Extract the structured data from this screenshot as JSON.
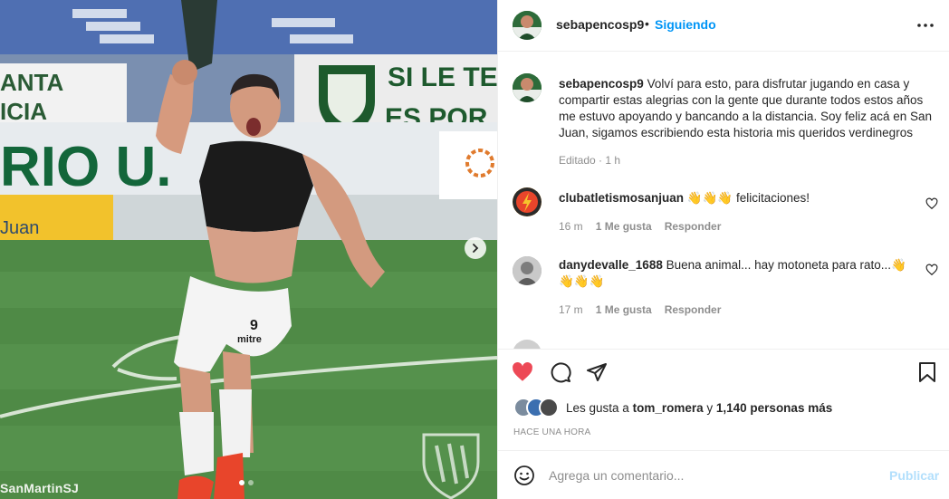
{
  "photo": {
    "watermark": "SanMartinSJ",
    "carousel": {
      "total": 2,
      "active": 1
    },
    "banner_texts": [
      "SI LE TE",
      "ES POR",
      "ANTA",
      "ICIA",
      "RIO U.",
      "Juan"
    ],
    "jersey_number": "9",
    "shorts_brand": "mitre"
  },
  "header": {
    "username": "sebapencosp9",
    "separator": "•",
    "follow_status": "Siguiendo"
  },
  "caption": {
    "username": "sebapencosp9",
    "text": "Volví para esto, para disfrutar jugando en casa y compartir estas alegrias con la gente que durante todos estos años me estuvo apoyando y bancando a la distancia. Soy feliz acá en San Juan, sigamos escribiendo esta historia mis queridos verdinegros",
    "meta": "Editado · 1 h"
  },
  "comments": [
    {
      "username": "clubatletismosanjuan",
      "text": "👋👋👋 felicitaciones!",
      "time": "16 m",
      "likes": "1 Me gusta",
      "reply": "Responder"
    },
    {
      "username": "danydevalle_1688",
      "text": "Buena animal... hay motoneta para rato...👋👋👋👋",
      "time": "17 m",
      "likes": "1 Me gusta",
      "reply": "Responder"
    }
  ],
  "likes": {
    "prefix": "Les gusta a",
    "user": "tom_romera",
    "middle": "y",
    "count": "1,140 personas más"
  },
  "timestamp": "HACE UNA HORA",
  "add_comment": {
    "placeholder": "Agrega un comentario...",
    "post_label": "Publicar"
  },
  "colors": {
    "like_red": "#ed4956",
    "link_blue": "#0095f6",
    "post_disabled": "#b2dffc",
    "muted_text": "#8e8e8e"
  },
  "icons": {
    "like": "heart-filled-icon",
    "comment": "comment-bubble-icon",
    "share": "paper-plane-icon",
    "save": "bookmark-icon",
    "more": "more-horizontal-icon",
    "emoji": "emoji-smile-icon",
    "next": "chevron-right-icon"
  }
}
